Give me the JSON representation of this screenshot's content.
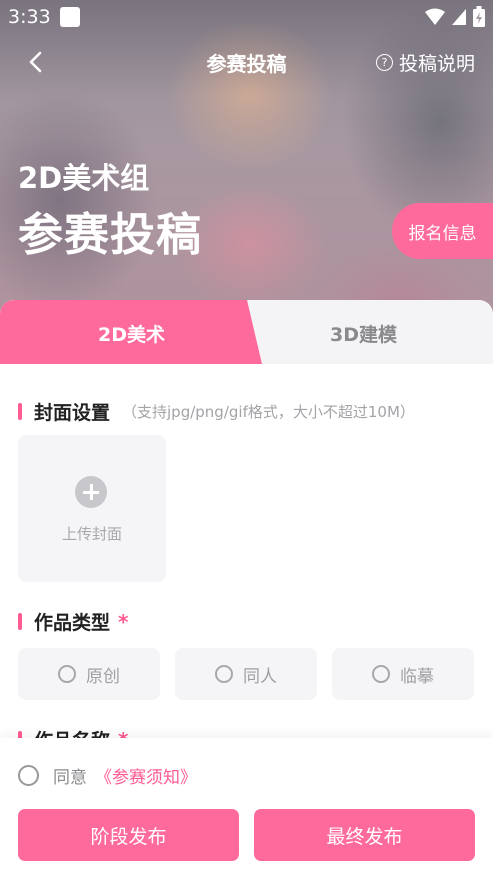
{
  "status_bar": {
    "time": "3:33"
  },
  "header": {
    "title": "参赛投稿",
    "help_label": "投稿说明"
  },
  "hero": {
    "subtitle": "2D美术组",
    "title": "参赛投稿",
    "register_button": "报名信息"
  },
  "tabs": [
    {
      "label": "2D美术",
      "active": true
    },
    {
      "label": "3D建模",
      "active": false
    }
  ],
  "cover": {
    "title": "封面设置",
    "hint": "（支持jpg/png/gif格式，大小不超过10M）",
    "upload_label": "上传封面"
  },
  "work_type": {
    "title": "作品类型",
    "required_mark": "*",
    "options": [
      "原创",
      "同人",
      "临摹"
    ]
  },
  "work_name": {
    "title": "作品名称",
    "required_mark": "*"
  },
  "agreement": {
    "prefix": "同意",
    "link": "《参赛须知》"
  },
  "actions": {
    "stage_publish": "阶段发布",
    "final_publish": "最终发布"
  },
  "colors": {
    "accent": "#ff6a9c",
    "accent_text": "#ff5b93",
    "tab_inactive_bg": "#f4f4f6"
  }
}
